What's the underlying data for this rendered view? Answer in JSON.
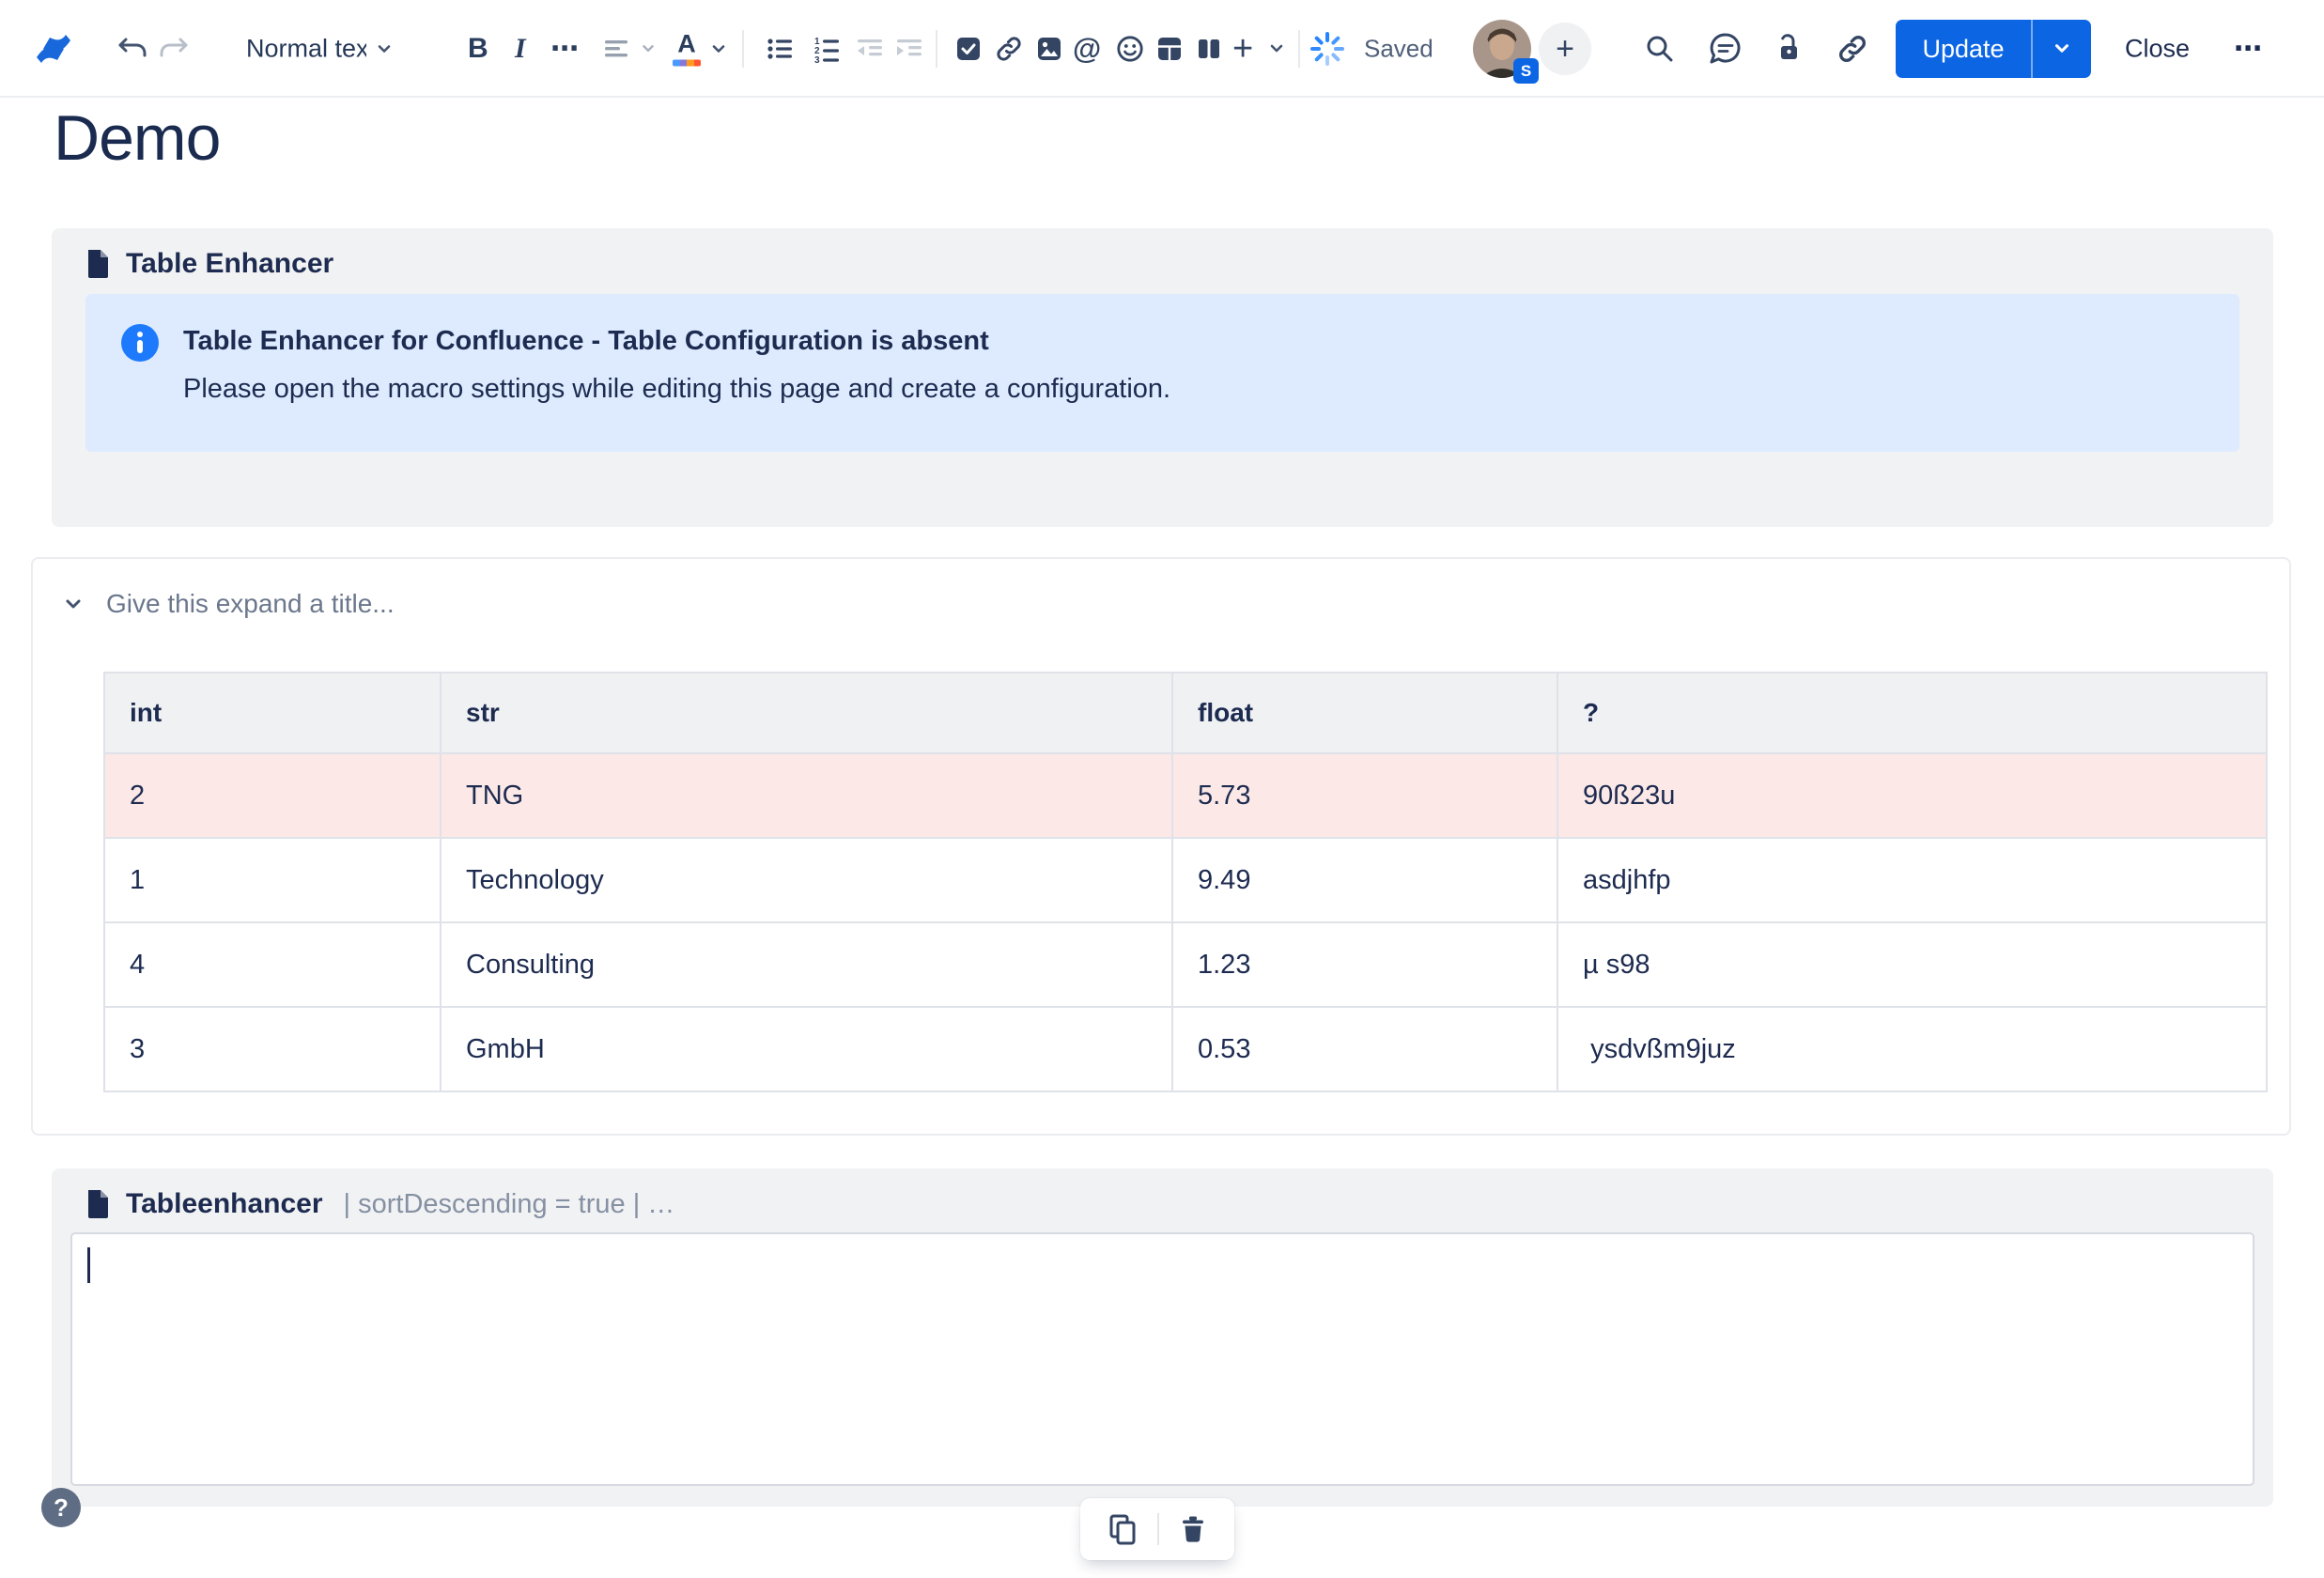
{
  "toolbar": {
    "block_style_label": "Normal text",
    "bold_glyph": "B",
    "italic_glyph": "I",
    "more_glyph": "⋯",
    "mention_glyph": "@",
    "insert_plus_glyph": "+",
    "saved_label": "Saved",
    "avatar_badge": "S",
    "invite_plus_glyph": "+",
    "update_label": "Update",
    "close_label": "Close",
    "overflow_glyph": "⋯"
  },
  "page": {
    "title": "Demo"
  },
  "macro_table_enhancer": {
    "name": "Table Enhancer",
    "info_title": "Table Enhancer for Confluence - Table Configuration is absent",
    "info_body": "Please open the macro settings while editing this page and create a configuration."
  },
  "expand": {
    "title_placeholder": "Give this expand a title...",
    "table": {
      "headers": [
        "int",
        "str",
        "float",
        "?"
      ],
      "rows": [
        {
          "highlight": true,
          "cells": [
            "2",
            "TNG",
            "5.73",
            "90ß23u"
          ]
        },
        {
          "highlight": false,
          "cells": [
            "1",
            "Technology",
            "9.49",
            "asdjhfp"
          ]
        },
        {
          "highlight": false,
          "cells": [
            "4",
            "Consulting",
            "1.23",
            "µ s98"
          ]
        },
        {
          "highlight": false,
          "cells": [
            "3",
            "GmbH",
            "0.53",
            " ysdvßm9juz"
          ]
        }
      ]
    }
  },
  "macro_tableenhancer": {
    "name": "Tableenhancer",
    "params_display": "| sortDescending = true | …",
    "body": ""
  },
  "help": {
    "glyph": "?"
  },
  "colors": {
    "accent_blue": "#0c66e4",
    "logo_blue": "#1868db",
    "info_banner_bg": "#deebff",
    "info_icon_blue": "#1d7afc",
    "highlight_row_pink": "#fce9e7",
    "panel_gray": "#f1f2f4",
    "text_navy": "#172b4d",
    "muted_gray": "#6b778c"
  }
}
